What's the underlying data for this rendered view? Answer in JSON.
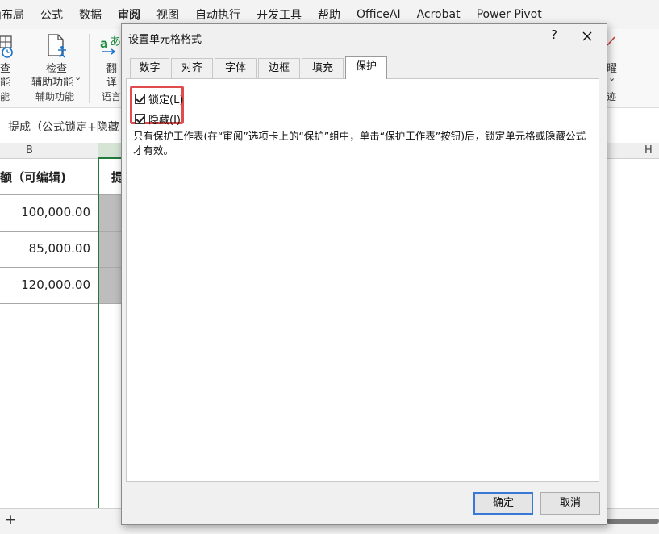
{
  "menu": {
    "items": [
      "面布局",
      "公式",
      "数据",
      "审阅",
      "视图",
      "自动执行",
      "开发工具",
      "帮助",
      "OfficeAI",
      "Acrobat",
      "Power Pivot"
    ],
    "active_index": 3
  },
  "ribbon": {
    "left_btn_line1": "查",
    "left_btn_line2": "能",
    "left_group_name": "能",
    "accessibility_btn_line1": "检查",
    "accessibility_btn_line2": "辅助功能",
    "accessibility_btn_arrow": "⌄",
    "accessibility_group_name": "辅助功能",
    "translate_btn_line1": "翻",
    "translate_btn_line2": "译",
    "translate_group_name": "语言",
    "right_btn_text": "曜",
    "right_group_name": "迹"
  },
  "formula_bar": {
    "text": "提成（公式锁定+隐藏"
  },
  "grid": {
    "columns": [
      "B",
      "H"
    ],
    "header_cell": "额（可编辑)",
    "c_header_partial": "提",
    "values": [
      "100,000.00",
      "85,000.00",
      "120,000.00"
    ]
  },
  "sheet_bar": {
    "add_sheet": "+"
  },
  "dialog": {
    "title": "设置单元格格式",
    "help": "?",
    "tabs": [
      "数字",
      "对齐",
      "字体",
      "边框",
      "填充",
      "保护"
    ],
    "active_tab": "保护",
    "checkboxes": [
      {
        "label": "锁定(L)",
        "checked": true
      },
      {
        "label": "隐藏(I)",
        "checked": true
      }
    ],
    "note": "只有保护工作表(在“审阅”选项卡上的“保护”组中，单击“保护工作表”按钮)后，锁定单元格或隐藏公式才有效。",
    "ok_label": "确定",
    "cancel_label": "取消"
  },
  "colors": {
    "highlight": "#e14b4b",
    "accent": "#3a78d6",
    "selected_column": "#bdbdbd"
  }
}
